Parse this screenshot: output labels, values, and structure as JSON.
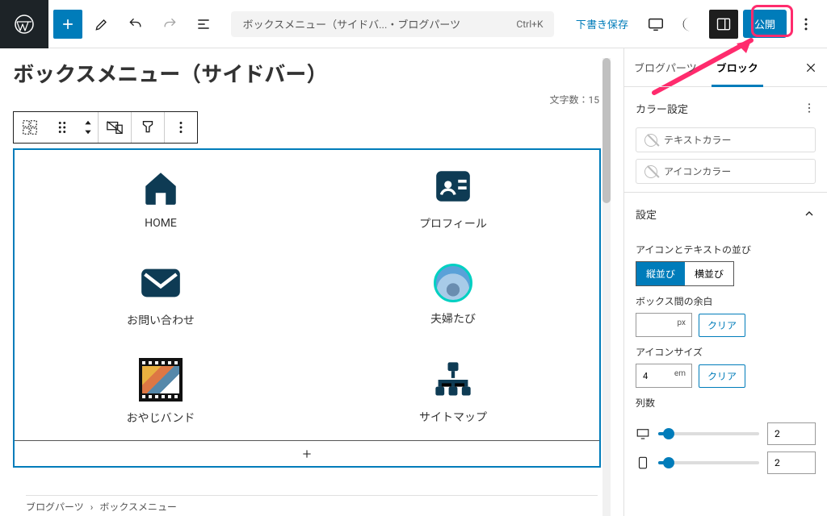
{
  "topbar": {
    "doc_title": "ボックスメニュー（サイドバ...・ブログパーツ",
    "shortcut": "Ctrl+K",
    "save_draft": "下書き保存",
    "publish": "公開"
  },
  "editor": {
    "title": "ボックスメニュー（サイドバー）",
    "word_count_label": "文字数：15",
    "cells": [
      {
        "label": "HOME",
        "icon": "home"
      },
      {
        "label": "プロフィール",
        "icon": "profile-card"
      },
      {
        "label": "お問い合わせ",
        "icon": "envelope"
      },
      {
        "label": "夫婦たび",
        "icon": "avatar"
      },
      {
        "label": "おやじバンド",
        "icon": "band"
      },
      {
        "label": "サイトマップ",
        "icon": "sitemap"
      }
    ]
  },
  "breadcrumb": {
    "root": "ブログパーツ",
    "sep": "›",
    "current": "ボックスメニュー"
  },
  "sidebar": {
    "tabs": {
      "parts": "ブログパーツ",
      "block": "ブロック"
    },
    "color_panel": {
      "title": "カラー設定",
      "text_color": "テキストカラー",
      "icon_color": "アイコンカラー"
    },
    "settings_panel": {
      "title": "設定"
    },
    "align": {
      "label": "アイコンとテキストの並び",
      "v": "縦並び",
      "h": "横並び"
    },
    "gap": {
      "label": "ボックス間の余白",
      "unit": "px",
      "clear": "クリア",
      "value": ""
    },
    "iconsize": {
      "label": "アイコンサイズ",
      "unit": "em",
      "clear": "クリア",
      "value": "4"
    },
    "cols": {
      "label": "列数",
      "rows": [
        {
          "value": "2"
        },
        {
          "value": "2"
        }
      ]
    }
  }
}
